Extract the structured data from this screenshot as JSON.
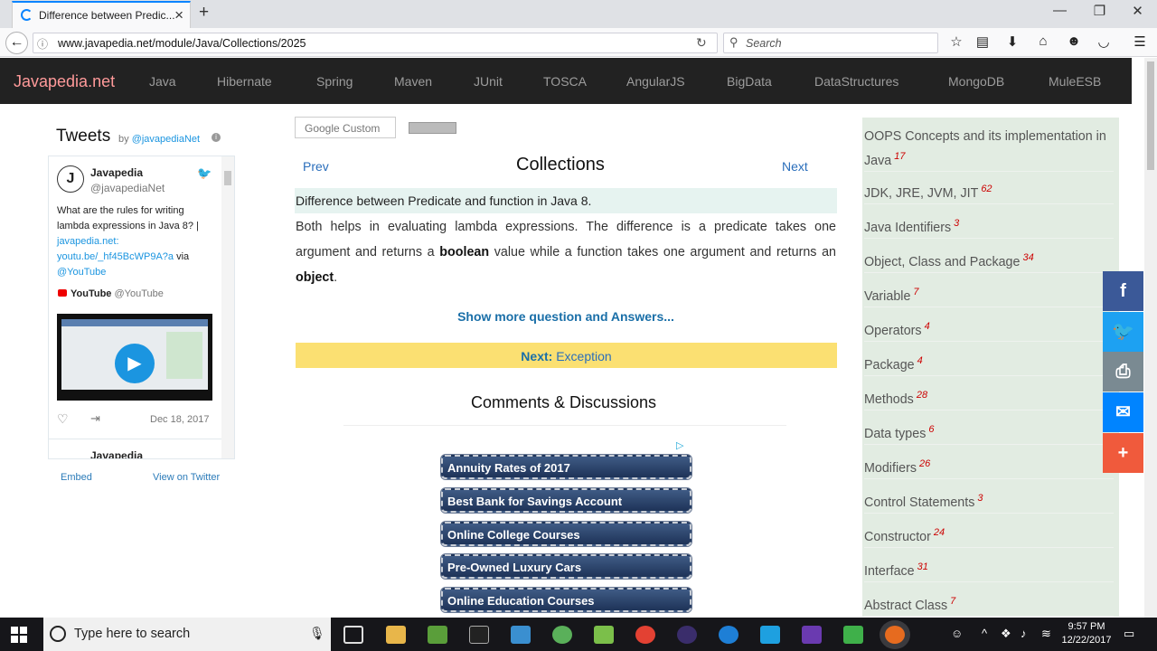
{
  "browser": {
    "tab_title": "Difference between Predic...",
    "url": "www.javapedia.net/module/Java/Collections/2025",
    "search_placeholder": "Search"
  },
  "site": {
    "brand": "Javapedia.net",
    "nav": [
      "Java",
      "Hibernate",
      "Spring",
      "Maven",
      "JUnit",
      "TOSCA",
      "AngularJS",
      "BigData",
      "DataStructures",
      "MongoDB",
      "MuleESB"
    ]
  },
  "twitter": {
    "heading": "Tweets",
    "by": "by",
    "handle_link": "@javapediaNet",
    "name": "Javapedia",
    "handle": "@javapediaNet",
    "tweet_text": "What are the rules for writing lambda expressions in Java 8? |",
    "tweet_link": "javapedia.net: youtu.be/_hf45BcWP9A?a",
    "tweet_via": "via",
    "tweet_youtube": "@YouTube",
    "yt_name": "YouTube",
    "yt_handle": "@YouTube",
    "date": "Dec 18, 2017",
    "next_name": "Javapedia",
    "embed": "Embed",
    "view_on_twitter": "View on Twitter"
  },
  "main": {
    "google_custom": "Google Custom",
    "prev": "Prev",
    "title": "Collections",
    "next": "Next",
    "question": "Difference between Predicate and function in Java 8.",
    "answer_1": "Both helps in evaluating lambda expressions. The difference is a predicate takes one argument and returns a ",
    "answer_bold_1": "boolean",
    "answer_2": " value while a function takes one argument and returns an ",
    "answer_bold_2": "object",
    "answer_3": ".",
    "show_more": "Show more question and Answers...",
    "next_label": "Next:",
    "next_topic": "Exception",
    "comments": "Comments & Discussions"
  },
  "ads": [
    "Annuity Rates of 2017",
    "Best Bank for Savings Account",
    "Online College Courses",
    "Pre-Owned Luxury Cars",
    "Online Education Courses"
  ],
  "topics": [
    {
      "label": "OOPS Concepts and its implementation in Java",
      "count": "17"
    },
    {
      "label": "JDK, JRE, JVM, JIT",
      "count": "62"
    },
    {
      "label": "Java Identifiers",
      "count": "3"
    },
    {
      "label": "Object, Class and Package",
      "count": "34"
    },
    {
      "label": "Variable",
      "count": "7"
    },
    {
      "label": "Operators",
      "count": "4"
    },
    {
      "label": "Package",
      "count": "4"
    },
    {
      "label": "Methods",
      "count": "28"
    },
    {
      "label": "Data types",
      "count": "6"
    },
    {
      "label": "Modifiers",
      "count": "26"
    },
    {
      "label": "Control Statements",
      "count": "3"
    },
    {
      "label": "Constructor",
      "count": "24"
    },
    {
      "label": "Interface",
      "count": "31"
    },
    {
      "label": "Abstract Class",
      "count": "7"
    }
  ],
  "taskbar": {
    "search_placeholder": "Type here to search",
    "time": "9:57 PM",
    "date": "12/22/2017"
  },
  "colors": {
    "brand": "#ff9a9a",
    "facebook": "#3b5998",
    "twitter": "#1da1f2",
    "print": "#7a8a92",
    "messenger": "#0084ff",
    "more": "#f05a3c"
  }
}
